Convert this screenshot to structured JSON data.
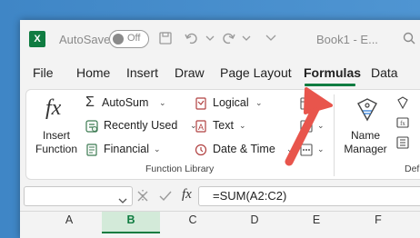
{
  "titlebar": {
    "app_icon_text": "X",
    "autosave_label": "AutoSave",
    "autosave_state": "Off",
    "doc_title": "Book1 - E..."
  },
  "menu": {
    "tabs": [
      "File",
      "Home",
      "Insert",
      "Draw",
      "Page Layout",
      "Formulas",
      "Data"
    ],
    "active": "Formulas"
  },
  "ribbon": {
    "insert_function_line1": "Insert",
    "insert_function_line2": "Function",
    "autosum": "AutoSum",
    "recently_used": "Recently Used",
    "financial": "Financial",
    "logical": "Logical",
    "text": "Text",
    "date_time": "Date & Time",
    "group_label": "Function Library",
    "name_manager_line1": "Name",
    "name_manager_line2": "Manager",
    "partial_right_label": "Def"
  },
  "formula_bar": {
    "fx_label": "fx",
    "formula": "=SUM(A2:C2)"
  },
  "columns": {
    "labels": [
      "A",
      "B",
      "C",
      "D",
      "E",
      "F"
    ],
    "selected": "B"
  },
  "colors": {
    "accent_green": "#107c41",
    "arrow_red": "#e8554c"
  }
}
